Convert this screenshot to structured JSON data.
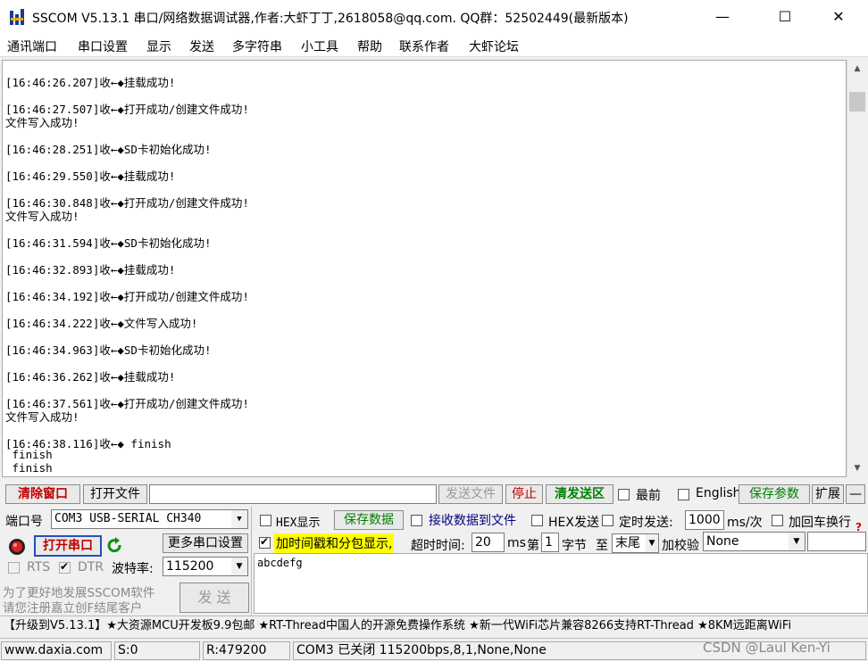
{
  "window": {
    "title": "SSCOM V5.13.1 串口/网络数据调试器,作者:大虾丁丁,2618058@qq.com. QQ群：52502449(最新版本)",
    "minimize": "—",
    "maximize": "☐",
    "close": "✕"
  },
  "menu": [
    "通讯端口",
    "串口设置",
    "显示",
    "发送",
    "多字符串",
    "小工具",
    "帮助",
    "联系作者",
    "大虾论坛"
  ],
  "log": [
    "[16:46:26.207]收←◆挂载成功!",
    "[16:46:27.507]收←◆打开成功/创建文件成功!",
    "文件写入成功!",
    "[16:46:28.251]收←◆SD卡初始化成功!",
    "[16:46:29.550]收←◆挂载成功!",
    "[16:46:30.848]收←◆打开成功/创建文件成功!",
    "文件写入成功!",
    "[16:46:31.594]收←◆SD卡初始化成功!",
    "[16:46:32.893]收←◆挂载成功!",
    "[16:46:34.192]收←◆打开成功/创建文件成功!",
    "[16:46:34.222]收←◆文件写入成功!",
    "[16:46:34.963]收←◆SD卡初始化成功!",
    "[16:46:36.262]收←◆挂载成功!",
    "[16:46:37.561]收←◆打开成功/创建文件成功!",
    "文件写入成功!",
    "[16:46:38.116]收←◆ finish",
    " finish",
    " finish"
  ],
  "toolbar": {
    "clear_window": "清除窗口",
    "open_file": "打开文件",
    "file_path": "",
    "send_file": "发送文件",
    "stop": "停止",
    "clear_send": "清发送区",
    "top_most": "最前",
    "english": "English",
    "save_params": "保存参数",
    "expand": "扩展",
    "collapse": "—"
  },
  "port": {
    "port_label": "端口号",
    "port_value": "COM3 USB-SERIAL CH340",
    "open_port": "打开串口",
    "more_settings": "更多串口设置",
    "rts": "RTS",
    "dtr": "DTR",
    "baud_label": "波特率:",
    "baud_value": "115200",
    "promo_line1": "为了更好地发展SSCOM软件",
    "promo_line2": "请您注册嘉立创F结尾客户",
    "send": "发 送"
  },
  "options": {
    "hex_display": "HEX显示",
    "save_data": "保存数据",
    "recv_to_file": "接收数据到文件",
    "hex_send": "HEX发送",
    "timed_send": "定时发送:",
    "interval": "1000",
    "interval_unit": "ms/次",
    "add_crlf": "加回车换行",
    "add_timestamp": "加时间戳和分包显示,",
    "timeout_label": "超时时间:",
    "timeout_value": "20",
    "timeout_unit": "ms",
    "nth_label": "第",
    "nth_value": "1",
    "byte_label": "字节",
    "to_label": "至",
    "end_value": "末尾",
    "checksum_label": "加校验",
    "checksum_value": "None"
  },
  "send_text": "abcdefg",
  "ticker": "【升级到V5.13.1】★大资源MCU开发板9.9包邮 ★RT-Thread中国人的开源免费操作系统 ★新一代WiFi芯片兼容8266支持RT-Thread ★8KM远距离WiFi",
  "status": {
    "site": "www.daxia.com",
    "sent": "S:0",
    "recv": "R:479200",
    "port_state": "COM3 已关闭  115200bps,8,1,None,None",
    "watermark": "CSDN @Laul Ken-Yi"
  },
  "colors": {
    "accent_red": "#c00000",
    "accent_green": "#008000",
    "highlight": "#ffff00"
  }
}
